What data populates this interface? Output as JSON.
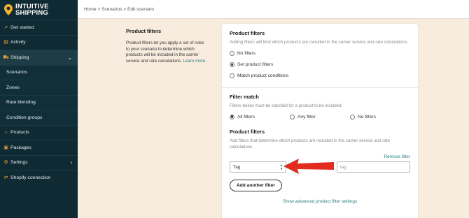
{
  "brand": {
    "line1": "INTUITIVE",
    "line2": "SHIPPING",
    "pin_icon": "location-pin-icon"
  },
  "sidebar": {
    "items": [
      {
        "label": "Get started",
        "icon": "rocket-icon"
      },
      {
        "label": "Activity",
        "icon": "activity-icon"
      },
      {
        "label": "Shipping",
        "icon": "truck-icon"
      },
      {
        "label": "Scenarios"
      },
      {
        "label": "Zones"
      },
      {
        "label": "Rate blending"
      },
      {
        "label": "Condition groups"
      },
      {
        "label": "Products",
        "icon": "tag-icon"
      },
      {
        "label": "Packages",
        "icon": "box-icon"
      },
      {
        "label": "Settings",
        "icon": "gear-icon"
      },
      {
        "label": "Shopify connection",
        "icon": "link-icon"
      }
    ]
  },
  "breadcrumb": "Home > Scenarios > Edit scenario",
  "description": {
    "title": "Product filters",
    "body": "Product filters let you apply a set of rules to your scenario to determine which products will be included in the carrier service and rate calculations.",
    "link": "Learn more."
  },
  "product_filters": {
    "title": "Product filters",
    "help": "Adding filters will limit which products are included in the carrier service and rate calculations.",
    "options": [
      "No filters",
      "Set product filters",
      "Match product conditions"
    ],
    "selected": "Set product filters"
  },
  "filter_match": {
    "title": "Filter match",
    "help": "Filters below must be satisfied for a product to be included.",
    "options": [
      "All filters",
      "Any filter",
      "No filters"
    ],
    "selected": "All filters"
  },
  "filters_section": {
    "title": "Product filters",
    "help": "Add filters that determine which products are included in the carrier service and rate calculations.",
    "remove_label": "Remove filter",
    "field_value": "Tag",
    "tag_placeholder": "tag",
    "add_button": "Add another filter",
    "advanced_link": "Show advanced product filter settings"
  },
  "colors": {
    "sidebar": "#0f2a33",
    "accent": "#2a7f84",
    "arrow": "#e32b1e",
    "background": "#f7ecdd",
    "icon": "#e6a03a"
  }
}
